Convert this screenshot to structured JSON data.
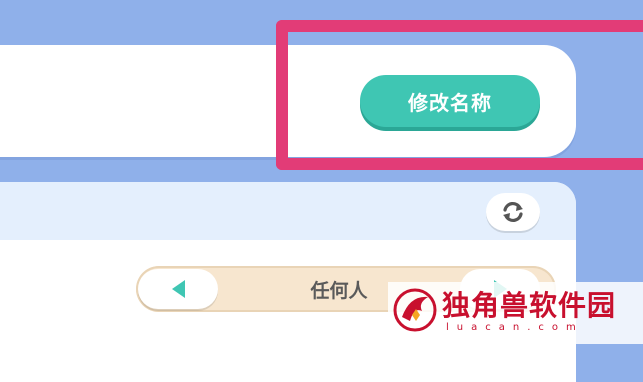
{
  "profile": {
    "rename_button_label": "修改名称"
  },
  "permission": {
    "selected_value": "任何人"
  },
  "icons": {
    "refresh": "refresh-icon",
    "prev": "triangle-left-icon",
    "next": "triangle-right-icon"
  },
  "watermark": {
    "title": "独角兽软件园",
    "subtitle": "luacan.com"
  },
  "colors": {
    "background": "#8fb0ea",
    "accent_teal": "#3fc6b3",
    "highlight": "#e23c77",
    "selector_bg": "#f7e6cf",
    "watermark": "#c8102e"
  }
}
